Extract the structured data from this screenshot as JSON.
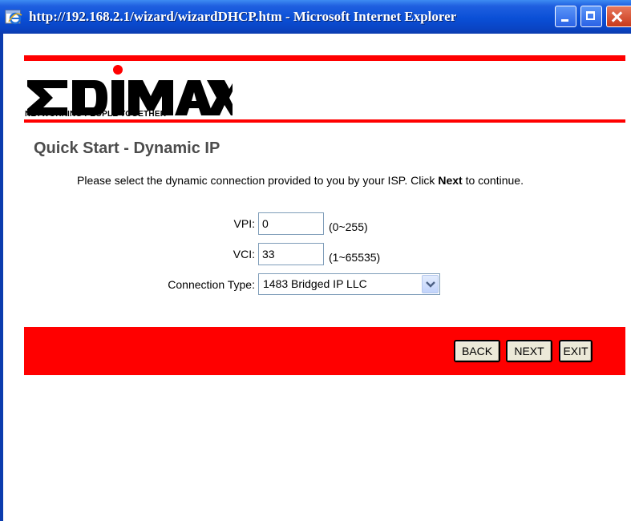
{
  "window": {
    "title": "http://192.168.2.1/wizard/wizardDHCP.htm - Microsoft Internet Explorer"
  },
  "logo": {
    "brand": "EDIMAX",
    "tagline": "NETWORKING PEOPLE TOGETHER"
  },
  "page": {
    "title": "Quick Start - Dynamic IP",
    "instructions_before": "Please select the dynamic connection provided to you by your ISP. Click ",
    "instructions_bold": "Next",
    "instructions_after": " to continue."
  },
  "form": {
    "vpi_label": "VPI:",
    "vpi_value": "0",
    "vpi_range": "(0~255)",
    "vci_label": "VCI:",
    "vci_value": "33",
    "vci_range": "(1~65535)",
    "connection_type_label": "Connection Type:",
    "connection_type_value": "1483 Bridged IP LLC"
  },
  "buttons": {
    "back": "BACK",
    "next": "NEXT",
    "exit": "EXIT"
  },
  "colors": {
    "accent_red": "#ff0000",
    "titlebar_blue": "#0a4fd6"
  }
}
